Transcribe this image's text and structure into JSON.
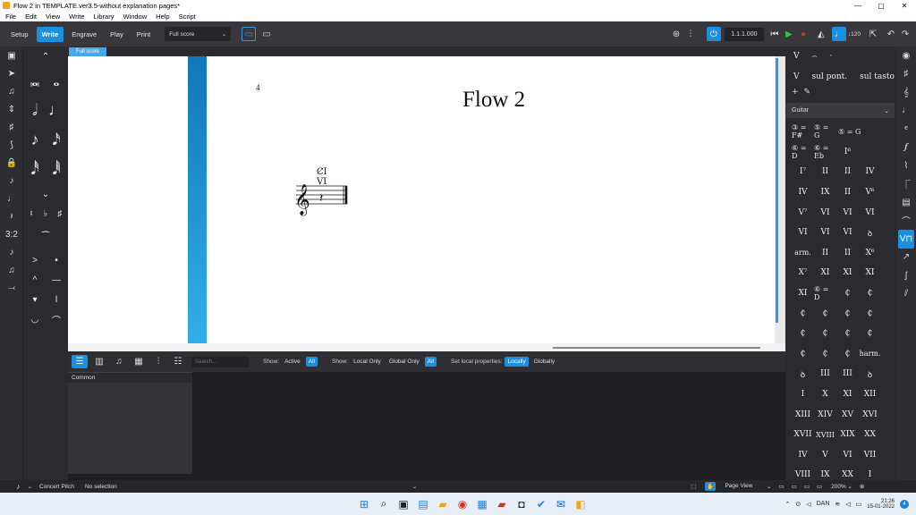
{
  "window": {
    "title": "Flow 2 in TEMPLATE.ver3.5-without explanation pages*",
    "controls": [
      "—",
      "▢",
      "✕"
    ]
  },
  "menu": [
    "File",
    "Edit",
    "View",
    "Write",
    "Library",
    "Window",
    "Help",
    "Script"
  ],
  "modes": [
    "Setup",
    "Write",
    "Engrave",
    "Play",
    "Print"
  ],
  "layout_select": "Full score",
  "transport": {
    "location": "1.1.1.000",
    "tempo": "120"
  },
  "tab": "Full score",
  "score": {
    "page_number": "4",
    "flow_title": "Flow 2"
  },
  "lower_toolbar": {
    "search_placeholder": "Search...",
    "show_label": "Show:",
    "show_opts": [
      "Active",
      "All"
    ],
    "show2_label": "Show:",
    "show2_opts": [
      "Local Only",
      "Global Only",
      "All"
    ],
    "local_label": "Set local properties:",
    "local_opts": [
      "Locally",
      "Globally"
    ]
  },
  "properties_group": "Common",
  "right_panel": {
    "top_row": [
      "V",
      "⌢",
      "·"
    ],
    "text_row": [
      "V",
      "sul pont.",
      "sul tasto"
    ],
    "section": "Guitar",
    "rows": [
      [
        "③ = F#",
        "⑤ = G",
        "⑤ = G"
      ],
      [
        "⑥ = D",
        "⑥ = Eb",
        "I⁶"
      ],
      [
        "I⁷",
        "II",
        "II",
        "IV"
      ],
      [
        "IV",
        "IX",
        "II",
        "V⁶"
      ],
      [
        "V⁷",
        "VI",
        "VI",
        "VI"
      ],
      [
        "VI",
        "VI",
        "VI",
        "ꝺ"
      ],
      [
        "arm.",
        "II",
        "II",
        "X⁶"
      ],
      [
        "X⁷",
        "XI",
        "XI",
        "XI"
      ],
      [
        "XI",
        "⑥ = D",
        "₵",
        "₵"
      ],
      [
        "₵",
        "₵",
        "₵",
        "₵"
      ],
      [
        "₵",
        "₵",
        "₵",
        "₵"
      ],
      [
        "₵",
        "₵",
        "₵",
        "harm."
      ],
      [
        "ꝺ",
        "III",
        "III",
        "ꝺ"
      ],
      [
        "I",
        "X",
        "XI",
        "XII"
      ],
      [
        "XIII",
        "XIV",
        "XV",
        "XVI"
      ],
      [
        "XVII",
        "XVIII",
        "XIX",
        "XX"
      ],
      [
        "IV",
        "V",
        "VI",
        "VII"
      ],
      [
        "VIII",
        "IX",
        "XX",
        "I"
      ]
    ]
  },
  "status": {
    "concert": "Concert Pitch",
    "selection": "No selection",
    "view": "Page View",
    "zoom": "200%"
  },
  "taskbar": {
    "lang": "DAN",
    "time": "21:26",
    "date": "15-01-2022"
  }
}
